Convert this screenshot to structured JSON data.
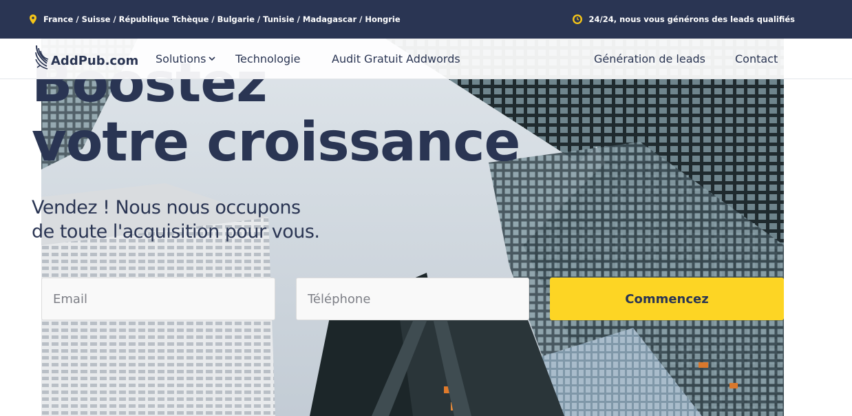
{
  "topbar": {
    "countries": "France / Suisse / République Tchèque / Bulgarie / Tunisie / Madagascar / Hongrie",
    "availability": "24/24, nous vous générons des leads qualifiés",
    "location_icon": "map-pin-icon",
    "clock_icon": "clock-icon",
    "accent_color": "#f5c518"
  },
  "nav": {
    "logo_text": "AddPub.com",
    "items": [
      {
        "label": "Solutions",
        "has_dropdown": true
      },
      {
        "label": "Technologie"
      },
      {
        "label": "Audit Gratuit Addwords"
      },
      {
        "label": "Génération de leads"
      },
      {
        "label": "Contact"
      }
    ]
  },
  "hero": {
    "headline_line1": "Boostez",
    "headline_line2": "votre croissance",
    "subheadline_line1": "Vendez ! Nous nous occupons",
    "subheadline_line2": "de toute l'acquisition pour vous."
  },
  "form": {
    "email_placeholder": "Email",
    "phone_placeholder": "Téléphone",
    "submit_label": "Commencez"
  },
  "colors": {
    "brand_navy": "#2a3553",
    "cta_yellow": "#fdd524"
  }
}
